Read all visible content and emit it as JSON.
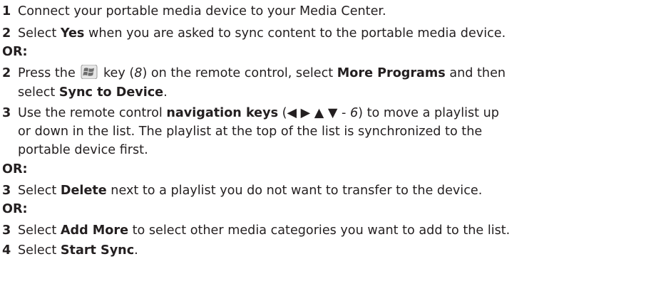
{
  "steps": {
    "s1": {
      "num": "1",
      "text": "Connect your portable media device to your Media Center."
    },
    "s2a": {
      "num": "2",
      "pre": "Select ",
      "bold": "Yes",
      "post": " when you are asked to sync content to the portable media device."
    },
    "or1": "OR:",
    "s2b": {
      "num": "2",
      "pre": "Press the ",
      "mid1": " key (",
      "key_ref": "8",
      "mid2": ") on the remote control, select ",
      "bold1": "More Programs",
      "post1": " and then",
      "line2_pre": "select ",
      "bold2": "Sync to Device",
      "line2_post": "."
    },
    "s3a": {
      "num": "3",
      "pre": "Use the remote control ",
      "bold": "navigation keys",
      "mid": " (◀ ▶ ▲ ▼ - ",
      "key_ref": "6",
      "post": ") to move a playlist up",
      "line2": "or down in the list. The playlist at the top of the list is synchronized to the",
      "line3": "portable device first."
    },
    "or2": "OR:",
    "s3b": {
      "num": "3",
      "pre": "Select ",
      "bold": "Delete",
      "post": " next to a playlist you do not want to transfer to the device."
    },
    "or3": "OR:",
    "s3c": {
      "num": "3",
      "pre": "Select ",
      "bold": "Add More",
      "post": " to select other media categories you want to add to the list."
    },
    "s4": {
      "num": "4",
      "pre": "Select ",
      "bold": "Start Sync",
      "post": "."
    }
  },
  "icons": {
    "windows_key": "windows-logo-key-icon"
  }
}
